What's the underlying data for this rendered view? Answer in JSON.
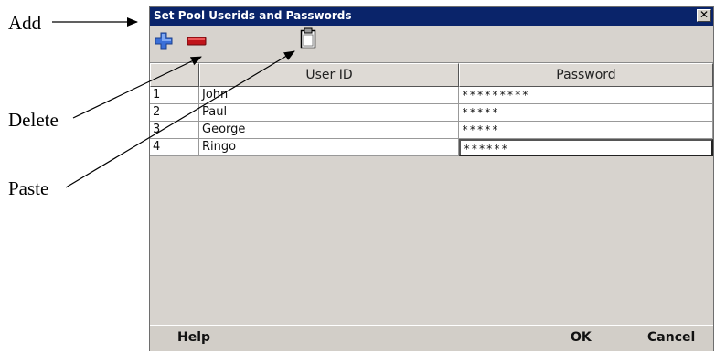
{
  "callouts": {
    "add": "Add",
    "delete": "Delete",
    "paste": "Paste"
  },
  "dialog": {
    "title": "Set Pool Userids and Passwords",
    "close_glyph": "✕"
  },
  "toolbar": {
    "add_icon": "plus-icon",
    "delete_icon": "minus-icon",
    "paste_icon": "clipboard-icon",
    "add_color": "#3a6fd8",
    "delete_color": "#c0141a"
  },
  "table": {
    "columns": [
      "",
      "User ID",
      "Password"
    ],
    "rows": [
      {
        "num": "1",
        "user": "John",
        "password": "*********"
      },
      {
        "num": "2",
        "user": "Paul",
        "password": "*****"
      },
      {
        "num": "3",
        "user": "George",
        "password": "*****"
      },
      {
        "num": "4",
        "user": "Ringo",
        "password": "******"
      }
    ]
  },
  "footer": {
    "help": "Help",
    "ok": "OK",
    "cancel": "Cancel"
  }
}
